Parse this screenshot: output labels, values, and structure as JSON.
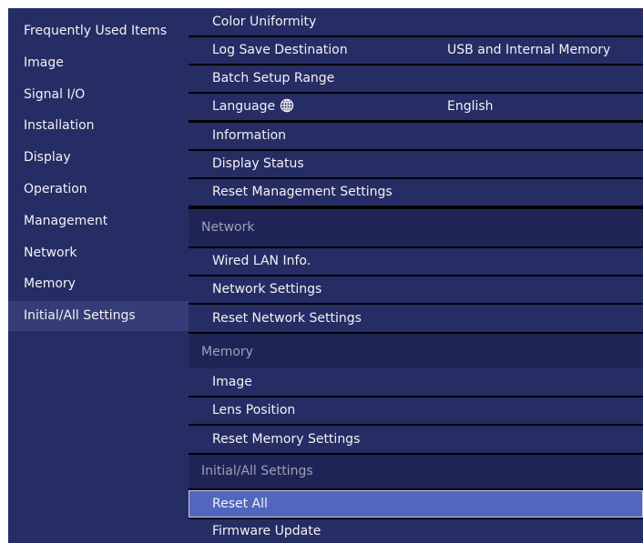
{
  "sidebar": {
    "items": [
      {
        "label": "Frequently Used Items"
      },
      {
        "label": "Image"
      },
      {
        "label": "Signal I/O"
      },
      {
        "label": "Installation"
      },
      {
        "label": "Display"
      },
      {
        "label": "Operation"
      },
      {
        "label": "Management"
      },
      {
        "label": "Network"
      },
      {
        "label": "Memory"
      },
      {
        "label": "Initial/All Settings"
      }
    ],
    "selected": "Initial/All Settings"
  },
  "main": {
    "rows": [
      {
        "type": "item",
        "label": "Color Uniformity",
        "value": ""
      },
      {
        "type": "item",
        "label": "Log Save Destination",
        "value": "USB and Internal Memory"
      },
      {
        "type": "item",
        "label": "Batch Setup Range",
        "value": ""
      },
      {
        "type": "item",
        "label": "Language",
        "value": "English",
        "icon": "globe-icon"
      },
      {
        "type": "item",
        "label": "Information",
        "value": ""
      },
      {
        "type": "item",
        "label": "Display Status",
        "value": ""
      },
      {
        "type": "item",
        "label": "Reset Management Settings",
        "value": ""
      },
      {
        "type": "header",
        "label": "Network"
      },
      {
        "type": "item",
        "label": "Wired LAN Info.",
        "value": ""
      },
      {
        "type": "item",
        "label": "Network Settings",
        "value": ""
      },
      {
        "type": "item",
        "label": "Reset Network Settings",
        "value": ""
      },
      {
        "type": "header",
        "label": "Memory"
      },
      {
        "type": "item",
        "label": "Image",
        "value": ""
      },
      {
        "type": "item",
        "label": "Lens Position",
        "value": ""
      },
      {
        "type": "item",
        "label": "Reset Memory Settings",
        "value": ""
      },
      {
        "type": "header",
        "label": "Initial/All Settings"
      },
      {
        "type": "item",
        "label": "Reset All",
        "value": "",
        "selected": true
      },
      {
        "type": "item",
        "label": "Firmware Update",
        "value": ""
      }
    ]
  },
  "colors": {
    "sidebar_bg": "#262c64",
    "row_bg": "#262c64",
    "header_bg": "#1f2456",
    "selected_bg": "#5366bd",
    "frame_bg": "#000000",
    "text": "#f2f2f2",
    "header_text": "#9ea0b8"
  }
}
